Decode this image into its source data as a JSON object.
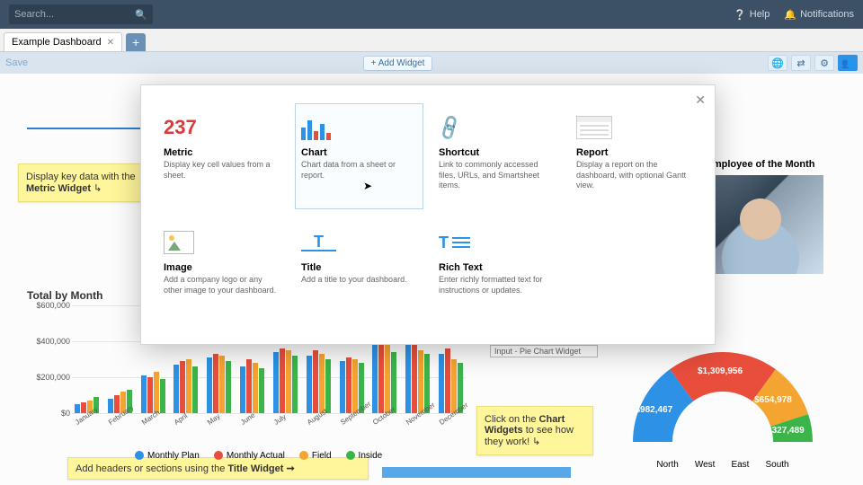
{
  "search": {
    "placeholder": "Search..."
  },
  "top_nav": {
    "help": "Help",
    "notifications": "Notifications"
  },
  "tab": {
    "name": "Example Dashboard"
  },
  "toolbar": {
    "save": "Save",
    "add_widget": "+ Add Widget"
  },
  "sticky1_html": "Display key data with the <b>Metric Widget</b> ↳",
  "sticky2_html": "Click on the <b>Chart Widgets</b> to see how they work! ↳",
  "sticky3_html": "Add headers or sections using the <b>Title Widget ➞</b>",
  "eotm": {
    "title": "Employee of the Month"
  },
  "widgets": {
    "metric": {
      "title": "Metric",
      "desc": "Display key cell values from a sheet.",
      "example_number": "237"
    },
    "chart": {
      "title": "Chart",
      "desc": "Chart data from a sheet or report."
    },
    "shortcut": {
      "title": "Shortcut",
      "desc": "Link to commonly accessed files, URLs, and Smartsheet items."
    },
    "report": {
      "title": "Report",
      "desc": "Display a report on the dashboard, with optional Gantt view."
    },
    "image": {
      "title": "Image",
      "desc": "Add a company logo or any other image to your dashboard."
    },
    "titlew": {
      "title": "Title",
      "desc": "Add a title to your dashboard."
    },
    "richtext": {
      "title": "Rich Text",
      "desc": "Enter richly formatted text for instructions or updates."
    }
  },
  "pie_input_label": "Input - Pie Chart Widget",
  "chart_data": {
    "bar": {
      "type": "bar",
      "title": "Total by Month",
      "categories": [
        "January",
        "February",
        "March",
        "April",
        "May",
        "June",
        "July",
        "August",
        "September",
        "October",
        "November",
        "December"
      ],
      "series": [
        {
          "name": "Monthly Plan",
          "values": [
            50000,
            80000,
            210000,
            270000,
            310000,
            260000,
            340000,
            320000,
            290000,
            400000,
            380000,
            330000
          ]
        },
        {
          "name": "Monthly Actual",
          "values": [
            60000,
            100000,
            200000,
            290000,
            330000,
            300000,
            360000,
            350000,
            310000,
            380000,
            410000,
            360000
          ]
        },
        {
          "name": "Field",
          "values": [
            70000,
            120000,
            230000,
            300000,
            320000,
            280000,
            350000,
            330000,
            300000,
            430000,
            350000,
            300000
          ]
        },
        {
          "name": "Inside",
          "values": [
            90000,
            130000,
            190000,
            260000,
            290000,
            250000,
            320000,
            300000,
            280000,
            340000,
            330000,
            280000
          ]
        }
      ],
      "ylabel": "",
      "ylim": [
        0,
        600000
      ],
      "y_ticks": [
        0,
        200000,
        400000,
        600000
      ],
      "y_tick_labels": [
        "$0",
        "$200,000",
        "$400,000",
        "$600,000"
      ]
    },
    "donut": {
      "type": "pie",
      "series": [
        {
          "name": "North",
          "value": 982467,
          "label": "$982,467",
          "color": "#2d91e5"
        },
        {
          "name": "West",
          "value": 1309956,
          "label": "$1,309,956",
          "color": "#e94e3c"
        },
        {
          "name": "East",
          "value": 654978,
          "label": "$654,978",
          "color": "#f4a431"
        },
        {
          "name": "South",
          "value": 327489,
          "label": "$327,489",
          "color": "#3bb54a"
        }
      ]
    }
  }
}
